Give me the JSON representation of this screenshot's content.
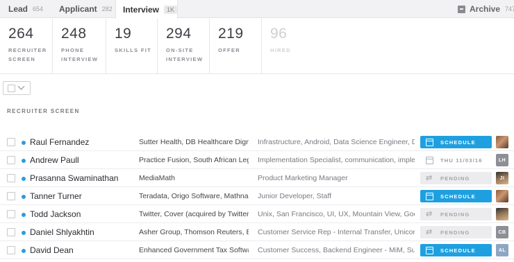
{
  "tabs": [
    {
      "label": "Lead",
      "count": "654"
    },
    {
      "label": "Applicant",
      "count": "282"
    },
    {
      "label": "Interview",
      "count": "1K"
    },
    {
      "label": "Archive",
      "count": "747"
    }
  ],
  "stages": [
    {
      "num": "264",
      "label1": "RECRUITER",
      "label2": "SCREEN"
    },
    {
      "num": "248",
      "label1": "PHONE",
      "label2": "INTERVIEW"
    },
    {
      "num": "19",
      "label1": "SKILLS FIT",
      "label2": ""
    },
    {
      "num": "294",
      "label1": "ON-SITE",
      "label2": "INTERVIEW"
    },
    {
      "num": "219",
      "label1": "OFFER",
      "label2": ""
    },
    {
      "num": "96",
      "label1": "HIRED",
      "label2": ""
    }
  ],
  "section_title": "RECRUITER SCREEN",
  "candidates": [
    {
      "name": "Raul Fernandez",
      "org": "Sutter Health, DB Healthcare Dignity ...",
      "tags": "Infrastructure, Android, Data Science Engineer, Data An",
      "action": "SCHEDULE",
      "avatar": ""
    },
    {
      "name": "Andrew Paull",
      "org": "Practice Fusion, South African Legisla...",
      "tags": "Implementation Specialist, communication, implement",
      "action": "THU 11/03/16",
      "avatar": "LH"
    },
    {
      "name": "Prasanna Swaminathan",
      "org": "MediaMath",
      "tags": "Product Marketing Manager",
      "action": "PENDING",
      "avatar": "JI"
    },
    {
      "name": "Tanner Turner",
      "org": "Teradata, Origo Software, Mathnasiu...",
      "tags": "Junior Developer, Staff",
      "action": "SCHEDULE",
      "avatar": ""
    },
    {
      "name": "Todd Jackson",
      "org": "Twitter, Cover (acquired by Twitter), F...",
      "tags": "Unix, San Francisco, UI, UX, Mountain View, Google, De",
      "action": "PENDING",
      "avatar": ""
    },
    {
      "name": "Daniel Shlyakhtin",
      "org": "Asher Group, Thomson Reuters, Borla...",
      "tags": "Customer Service Rep - Internal Transfer, Unicorn traine",
      "action": "PENDING",
      "avatar": "CB"
    },
    {
      "name": "David Dean",
      "org": "Enhanced Government Tax Software, ...",
      "tags": "Customer Success, Backend Engineer - MiM, Support Sp",
      "action": "SCHEDULE",
      "avatar": "AL"
    }
  ],
  "colors": {
    "accent": "#1ea0e0",
    "dot": "#2f9bd9"
  }
}
